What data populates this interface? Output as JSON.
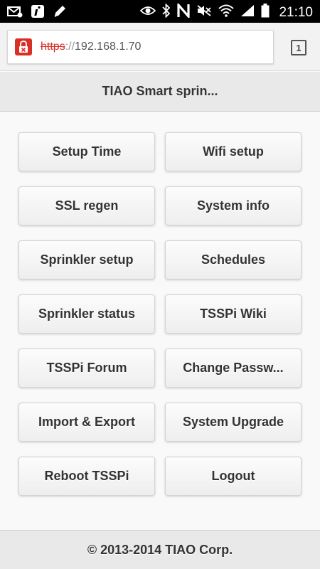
{
  "status_bar": {
    "time": "21:10",
    "left_icons": [
      "email-icon",
      "info-icon",
      "pencil-icon"
    ],
    "right_icons": [
      "eye-icon",
      "bluetooth-icon",
      "nfc-icon",
      "mute-icon",
      "wifi-icon",
      "signal-icon",
      "battery-icon"
    ]
  },
  "browser": {
    "url_scheme": "https",
    "url_separator": "://",
    "url_host": "192.168.1.70",
    "tab_count": "1",
    "accent_color": "#d93025"
  },
  "header": {
    "title": "TIAO Smart sprin..."
  },
  "menu": {
    "buttons": [
      {
        "label": "Setup Time"
      },
      {
        "label": "Wifi setup"
      },
      {
        "label": "SSL regen"
      },
      {
        "label": "System info"
      },
      {
        "label": "Sprinkler setup"
      },
      {
        "label": "Schedules"
      },
      {
        "label": "Sprinkler status"
      },
      {
        "label": "TSSPi Wiki"
      },
      {
        "label": "TSSPi Forum"
      },
      {
        "label": "Change Passw..."
      },
      {
        "label": "Import & Export"
      },
      {
        "label": "System Upgrade"
      },
      {
        "label": "Reboot TSSPi"
      },
      {
        "label": "Logout"
      }
    ]
  },
  "footer": {
    "text": "© 2013-2014 TIAO Corp."
  }
}
